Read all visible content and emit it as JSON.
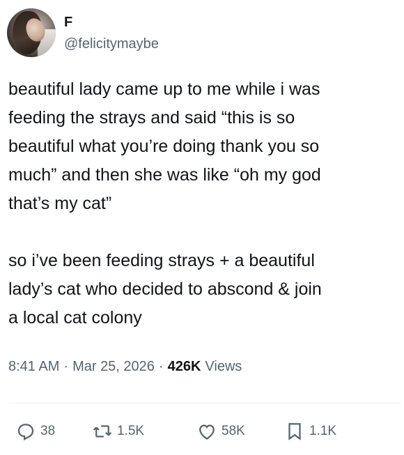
{
  "user": {
    "display_name": "F",
    "handle": "@felicitymaybe"
  },
  "tweet": {
    "paragraphs": [
      "beautiful lady came up to me while i was\nfeeding the strays and said “this is so\nbeautiful what you’re doing thank you so\nmuch” and then she was like “oh my god\nthat’s my cat”",
      "so i’ve been feeding strays + a beautiful\nlady’s cat who decided to abscond & join\na local cat colony"
    ]
  },
  "meta": {
    "time": "8:41 AM",
    "separator": "·",
    "date": "Mar 25, 2026",
    "views_count": "426K",
    "views_label": "Views"
  },
  "actions": {
    "replies": "38",
    "reposts": "1.5K",
    "likes": "58K",
    "bookmarks": "1.1K"
  },
  "icons": [
    "reply-icon",
    "repost-icon",
    "like-icon",
    "bookmark-icon"
  ],
  "colors": {
    "text": "#0f1419",
    "secondary": "#536471",
    "divider": "#eff3f4"
  }
}
